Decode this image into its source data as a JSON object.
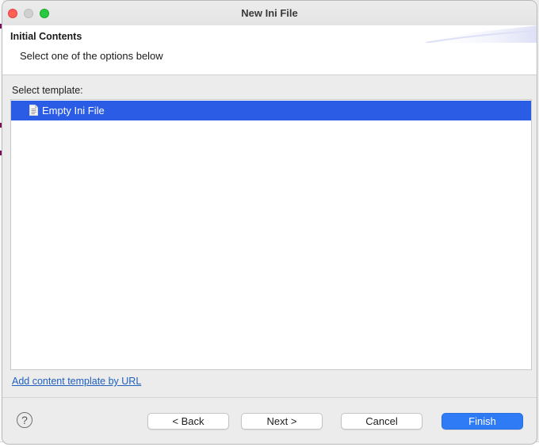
{
  "window": {
    "title": "New Ini File"
  },
  "header": {
    "title": "Initial Contents",
    "description": "Select one of the options below"
  },
  "templates": {
    "label": "Select template:",
    "items": [
      {
        "label": "Empty Ini File",
        "selected": true,
        "icon": "document-icon"
      }
    ]
  },
  "link": {
    "add_template": "Add content template by URL"
  },
  "buttons": {
    "help": "?",
    "back": "< Back",
    "next": "Next >",
    "cancel": "Cancel",
    "finish": "Finish"
  },
  "colors": {
    "selection": "#2b5ce6",
    "primary_button": "#2f7bf6",
    "link": "#1f5fbf"
  }
}
